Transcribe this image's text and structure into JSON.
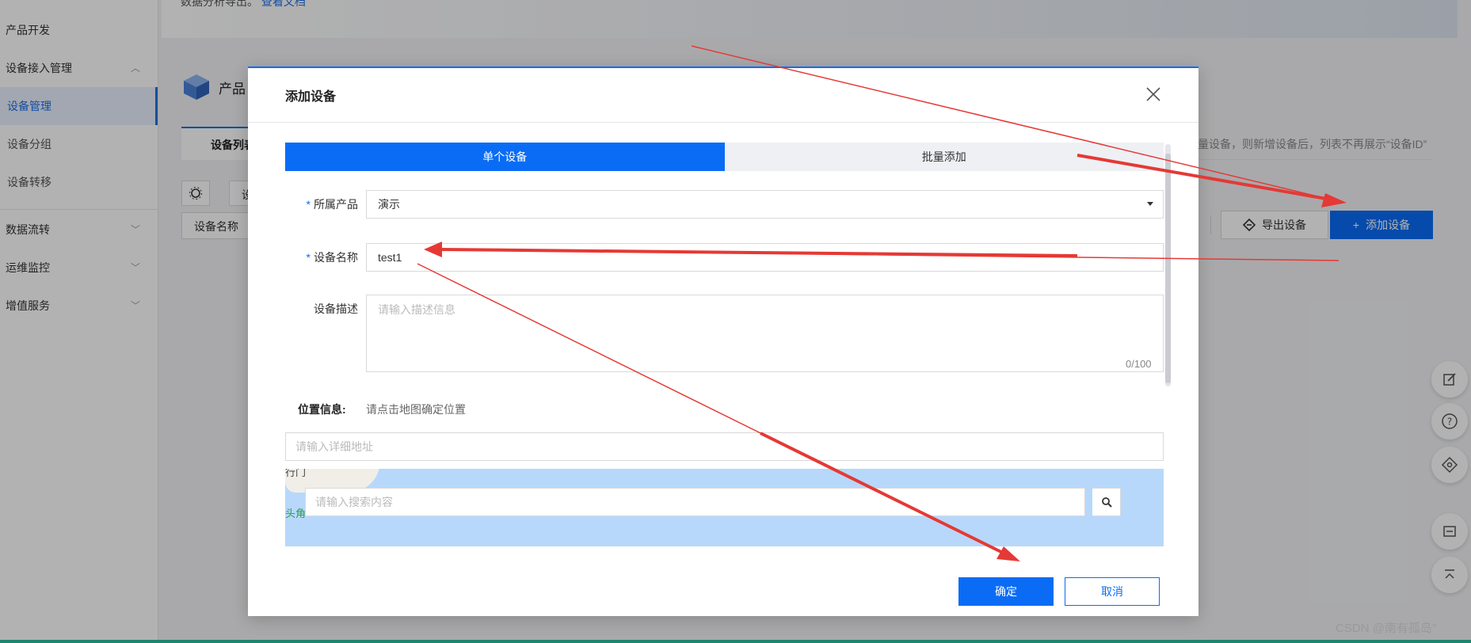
{
  "sidebar": {
    "items": [
      {
        "label": "产品开发"
      },
      {
        "label": "设备接入管理"
      },
      {
        "label": "设备管理"
      },
      {
        "label": "设备分组"
      },
      {
        "label": "设备转移"
      },
      {
        "label": "数据流转"
      },
      {
        "label": "运维监控"
      },
      {
        "label": "增值服务"
      }
    ]
  },
  "banner": {
    "text": "数据分析导出。",
    "link": "查看文档"
  },
  "page": {
    "product_title": "产品",
    "tab_label": "设备列表",
    "tip": "量设备，则新增设备后，列表不再展示“设备ID”",
    "column_device_name": "设备名称",
    "filter_label": "设",
    "export_button": "导出设备",
    "add_button": "添加设备"
  },
  "modal": {
    "title": "添加设备",
    "tabs": [
      {
        "label": "单个设备",
        "active": true
      },
      {
        "label": "批量添加",
        "active": false
      }
    ],
    "fields": {
      "product": {
        "label": "所属产品",
        "value": "演示",
        "required": true
      },
      "name": {
        "label": "设备名称",
        "value": "test1",
        "required": true
      },
      "description": {
        "label": "设备描述",
        "placeholder": "请输入描述信息",
        "counter": "0/100"
      }
    },
    "location": {
      "label": "位置信息:",
      "hint": "请点击地图确定位置",
      "address_placeholder": "请输入详细地址",
      "search_placeholder": "请输入搜索内容",
      "map_text_top": "行门",
      "map_text_left": "头角"
    },
    "ok_button": "确定",
    "cancel_button": "取消"
  },
  "watermark": "CSDN @南有孤岛°",
  "colors": {
    "primary": "#0a6cf5",
    "annotation": "#e53935"
  }
}
